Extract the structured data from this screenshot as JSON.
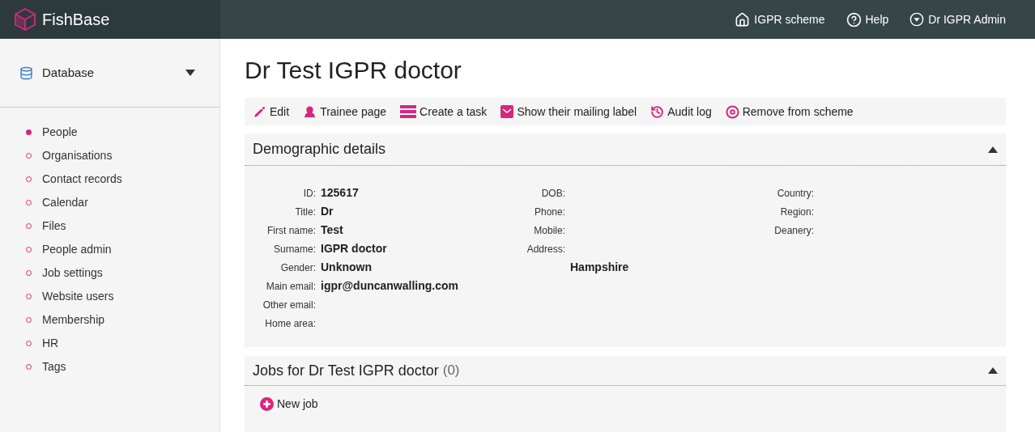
{
  "header": {
    "brand": "FishBase",
    "links": [
      {
        "label": "IGPR scheme"
      },
      {
        "label": "Help"
      },
      {
        "label": "Dr IGPR Admin"
      }
    ]
  },
  "sidebar": {
    "section": "Database",
    "expanded": true,
    "items": [
      {
        "label": "People",
        "selected": true
      },
      {
        "label": "Organisations",
        "selected": false
      },
      {
        "label": "Contact records",
        "selected": false
      },
      {
        "label": "Calendar",
        "selected": false
      },
      {
        "label": "Files",
        "selected": false
      },
      {
        "label": "People admin",
        "selected": false
      },
      {
        "label": "Job settings",
        "selected": false
      },
      {
        "label": "Website users",
        "selected": false
      },
      {
        "label": "Membership",
        "selected": false
      },
      {
        "label": "HR",
        "selected": false
      },
      {
        "label": "Tags",
        "selected": false
      }
    ]
  },
  "page_title": "Dr Test IGPR doctor",
  "actions": [
    "Edit",
    "Trainee page",
    "Create a task",
    "Show their mailing label",
    "Audit log",
    "Remove from scheme"
  ],
  "demographics": {
    "title": "Demographic details",
    "expanded": true,
    "columns": [
      [
        {
          "label": "ID:",
          "value": "125617"
        },
        {
          "label": "Title:",
          "value": "Dr"
        },
        {
          "label": "First name:",
          "value": "Test"
        },
        {
          "label": "Surname:",
          "value": "IGPR doctor"
        },
        {
          "label": "Gender:",
          "value": "Unknown"
        },
        {
          "label": "Main email:",
          "value": "igpr@duncanwalling.com"
        },
        {
          "label": "Other email:"
        },
        {
          "label": "Home area:"
        }
      ],
      [
        {
          "label": "DOB:"
        },
        {
          "label": "Phone:"
        },
        {
          "label": "Mobile:"
        },
        {
          "label": "Address:",
          "value_below": "Hampshire"
        }
      ],
      [
        {
          "label": "Country:"
        },
        {
          "label": "Region:"
        },
        {
          "label": "Deanery:"
        }
      ]
    ]
  },
  "jobs": {
    "title": "Jobs for Dr Test IGPR doctor",
    "count": "(0)",
    "expanded": true,
    "new_button": "New job"
  }
}
